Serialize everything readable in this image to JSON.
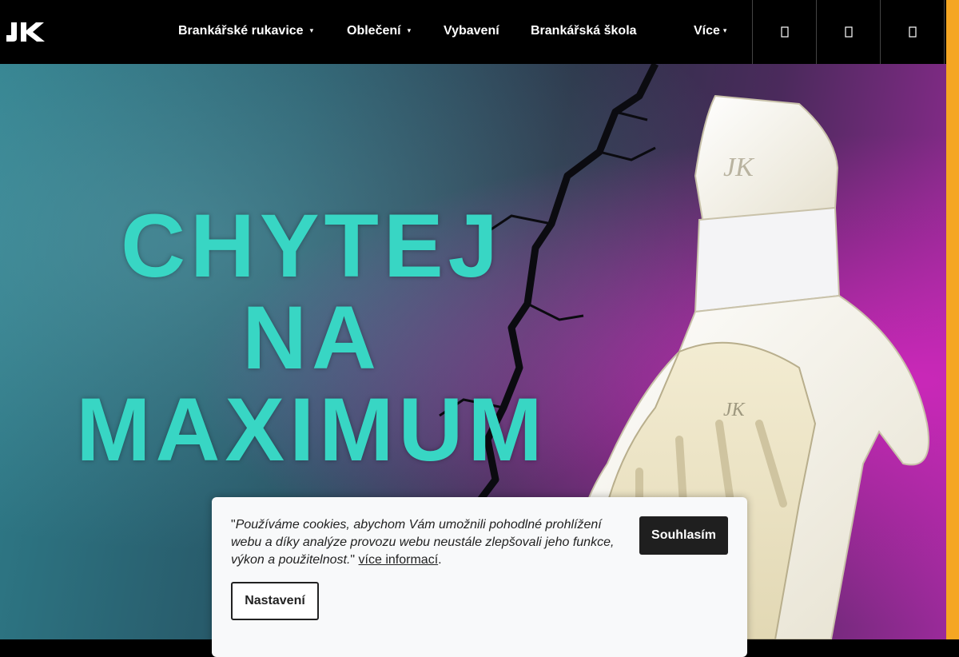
{
  "header": {
    "logo_text": "JK",
    "nav": [
      {
        "label": "Brankářské rukavice",
        "has_dropdown": true
      },
      {
        "label": "Oblečení",
        "has_dropdown": true
      },
      {
        "label": "Vybavení",
        "has_dropdown": false
      },
      {
        "label": "Brankářská škola",
        "has_dropdown": false
      },
      {
        "label": "Více",
        "has_dropdown": true
      }
    ],
    "icons": [
      "search-icon",
      "user-icon",
      "cart-icon"
    ]
  },
  "hero": {
    "headline": [
      "CHYTEJ",
      "NA",
      "MAXIMUM"
    ],
    "glove_signature": "JK"
  },
  "cookie": {
    "quote_open": "\"",
    "text": "Používáme cookies, abychom Vám umožnili pohodlné prohlížení webu a díky analýze provozu webu neustále zlepšovali jeho funkce, výkon a použitelnost.",
    "quote_close": "\" ",
    "link": "více informací",
    "end": ".",
    "accept_label": "Souhlasím",
    "settings_label": "Nastavení"
  },
  "colors": {
    "headline": "#38d6c4",
    "header_bg": "#000000",
    "scrollbar": "#f5a623",
    "button_dark": "#1f1f1f"
  }
}
